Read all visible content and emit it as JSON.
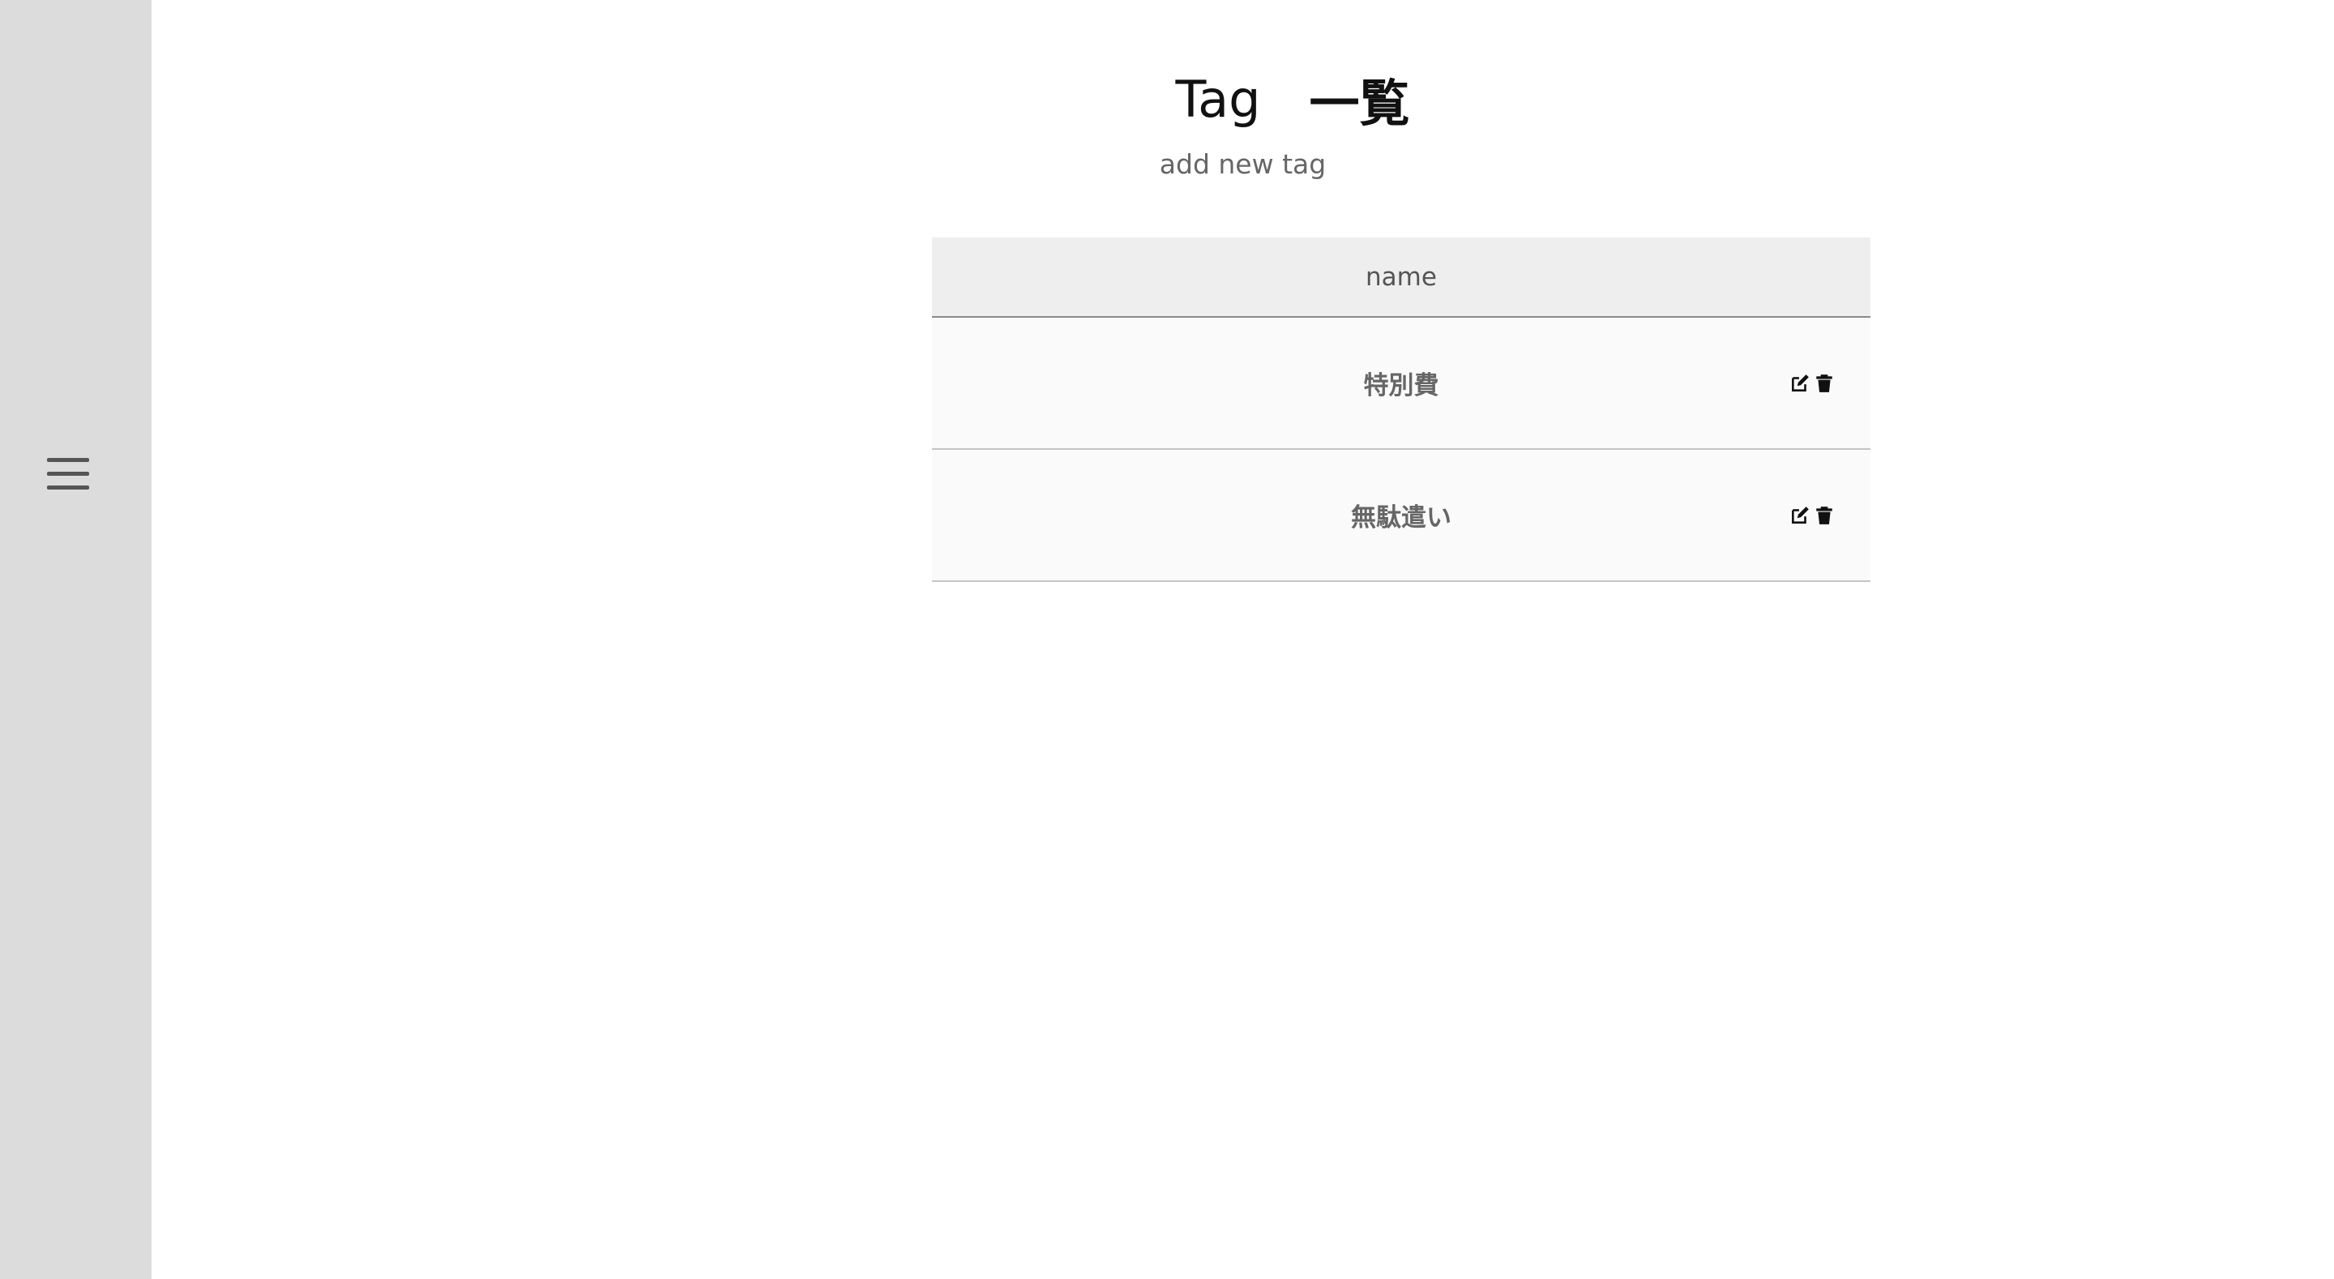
{
  "sidebar": {
    "menu_icon": "hamburger-menu-icon"
  },
  "header": {
    "title_en": "Tag",
    "title_jp": "一覧",
    "subtitle_link": "add new tag"
  },
  "table": {
    "column_header": "name",
    "rows": [
      {
        "name": "特別費",
        "edit_icon": "edit-icon",
        "delete_icon": "trash-icon"
      },
      {
        "name": "無駄遣い",
        "edit_icon": "edit-icon",
        "delete_icon": "trash-icon"
      }
    ]
  },
  "colors": {
    "sidebar_bg": "#dcdcdc",
    "header_bg": "#eeeeee",
    "row_bg": "#fafafa",
    "text_muted": "#666666",
    "title_text": "#111111"
  }
}
